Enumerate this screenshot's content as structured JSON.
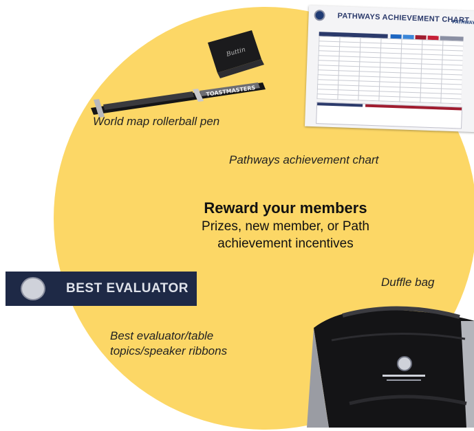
{
  "headline": {
    "title": "Reward your members",
    "subtitle_line1": "Prizes, new member, or Path",
    "subtitle_line2": "achievement incentives"
  },
  "captions": {
    "pen": "World map rollerball pen",
    "chart": "Pathways achievement chart",
    "duffle": "Duffle bag",
    "ribbon_line1": "Best evaluator/table",
    "ribbon_line2": "topics/speaker ribbons"
  },
  "chart_card": {
    "title": "PATHWAYS ACHIEVEMENT CHART",
    "brand": "PATHWAYS"
  },
  "ribbon": {
    "label": "BEST EVALUATOR"
  },
  "colors": {
    "circle": "#fcd766",
    "ribbon": "#1e2946",
    "chart_blue": "#1d3c78",
    "chart_red": "#a01c2f"
  }
}
